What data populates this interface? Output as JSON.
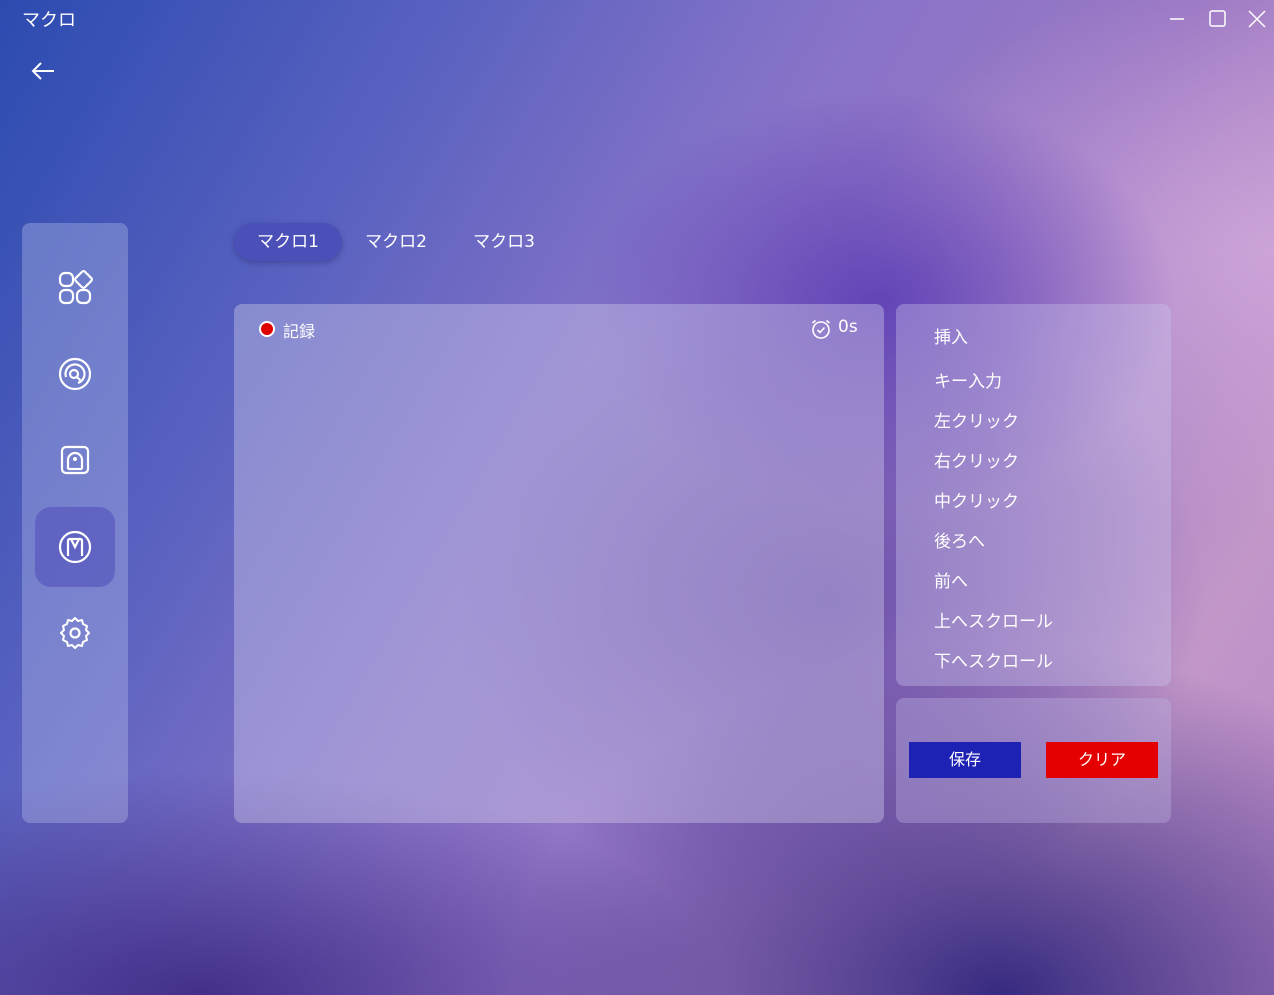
{
  "window": {
    "title": "マクロ",
    "controls": [
      "minimize-icon",
      "maximize-icon",
      "close-icon"
    ]
  },
  "sidebar": {
    "items": [
      {
        "icon": "apps-grid-icon",
        "active": false
      },
      {
        "icon": "search-target-icon",
        "active": false
      },
      {
        "icon": "profile-card-icon",
        "active": false
      },
      {
        "icon": "macro-m-icon",
        "active": true
      },
      {
        "icon": "gear-icon",
        "active": false
      }
    ]
  },
  "tabs": [
    {
      "label": "マクロ1",
      "active": true
    },
    {
      "label": "マクロ2",
      "active": false
    },
    {
      "label": "マクロ3",
      "active": false
    }
  ],
  "record": {
    "label": "記録",
    "timer": "0s"
  },
  "insert": {
    "title": "挿入",
    "items": [
      "キー入力",
      "左クリック",
      "右クリック",
      "中クリック",
      "後ろへ",
      "前へ",
      "上へスクロール",
      "下へスクロール"
    ]
  },
  "actions": {
    "save_label": "保存",
    "clear_label": "クリア"
  },
  "colors": {
    "save": "#1e22b4",
    "clear": "#e50000",
    "tab_active": "#4b4fb8",
    "record_dot": "#e00000"
  }
}
